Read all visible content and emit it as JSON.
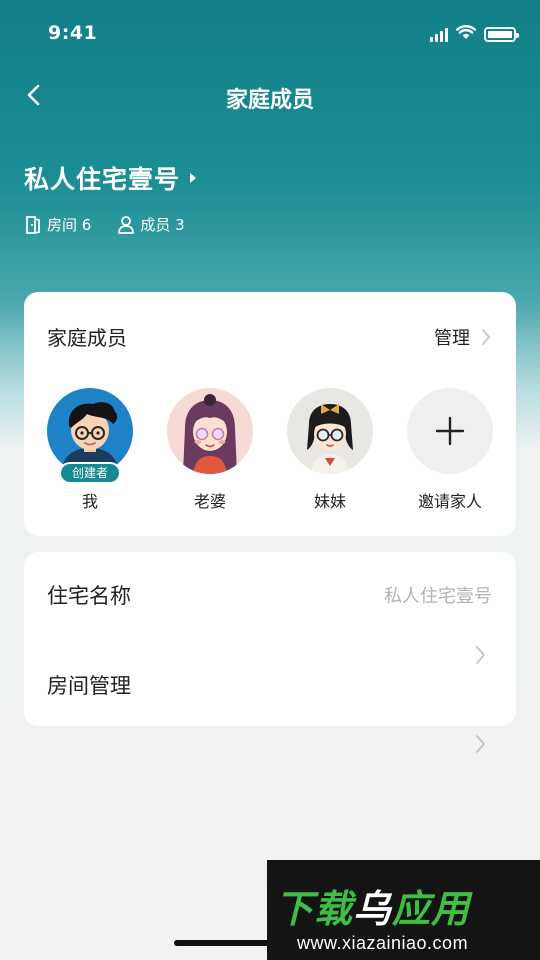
{
  "status_bar": {
    "time": "9:41",
    "icons": [
      "signal-icon",
      "wifi-icon",
      "battery-icon"
    ]
  },
  "nav": {
    "back_icon": "chevron-left-icon",
    "title": "家庭成员"
  },
  "home": {
    "name": "私人住宅壹号",
    "rooms_label": "房间 6",
    "members_label": "成员 3"
  },
  "members_card": {
    "title": "家庭成员",
    "manage_label": "管理",
    "members": [
      {
        "name": "我",
        "badge": "创建者",
        "avatar": "boy-with-glasses-avatar"
      },
      {
        "name": "老婆",
        "avatar": "girl-long-hair-avatar"
      },
      {
        "name": "妹妹",
        "avatar": "girl-with-bow-avatar"
      }
    ],
    "invite_label": "邀请家人"
  },
  "info_card": {
    "home_name_label": "住宅名称",
    "home_name_value": "私人住宅壹号",
    "room_manage_label": "房间管理"
  },
  "watermark": {
    "title_green_1": "下载",
    "title_white": "乌",
    "title_green_2": "应用",
    "url": "www.xiazainiao.com"
  },
  "colors": {
    "primary": "#168891",
    "header_gradient_top": "#117f88",
    "background": "#f1f2f2"
  }
}
